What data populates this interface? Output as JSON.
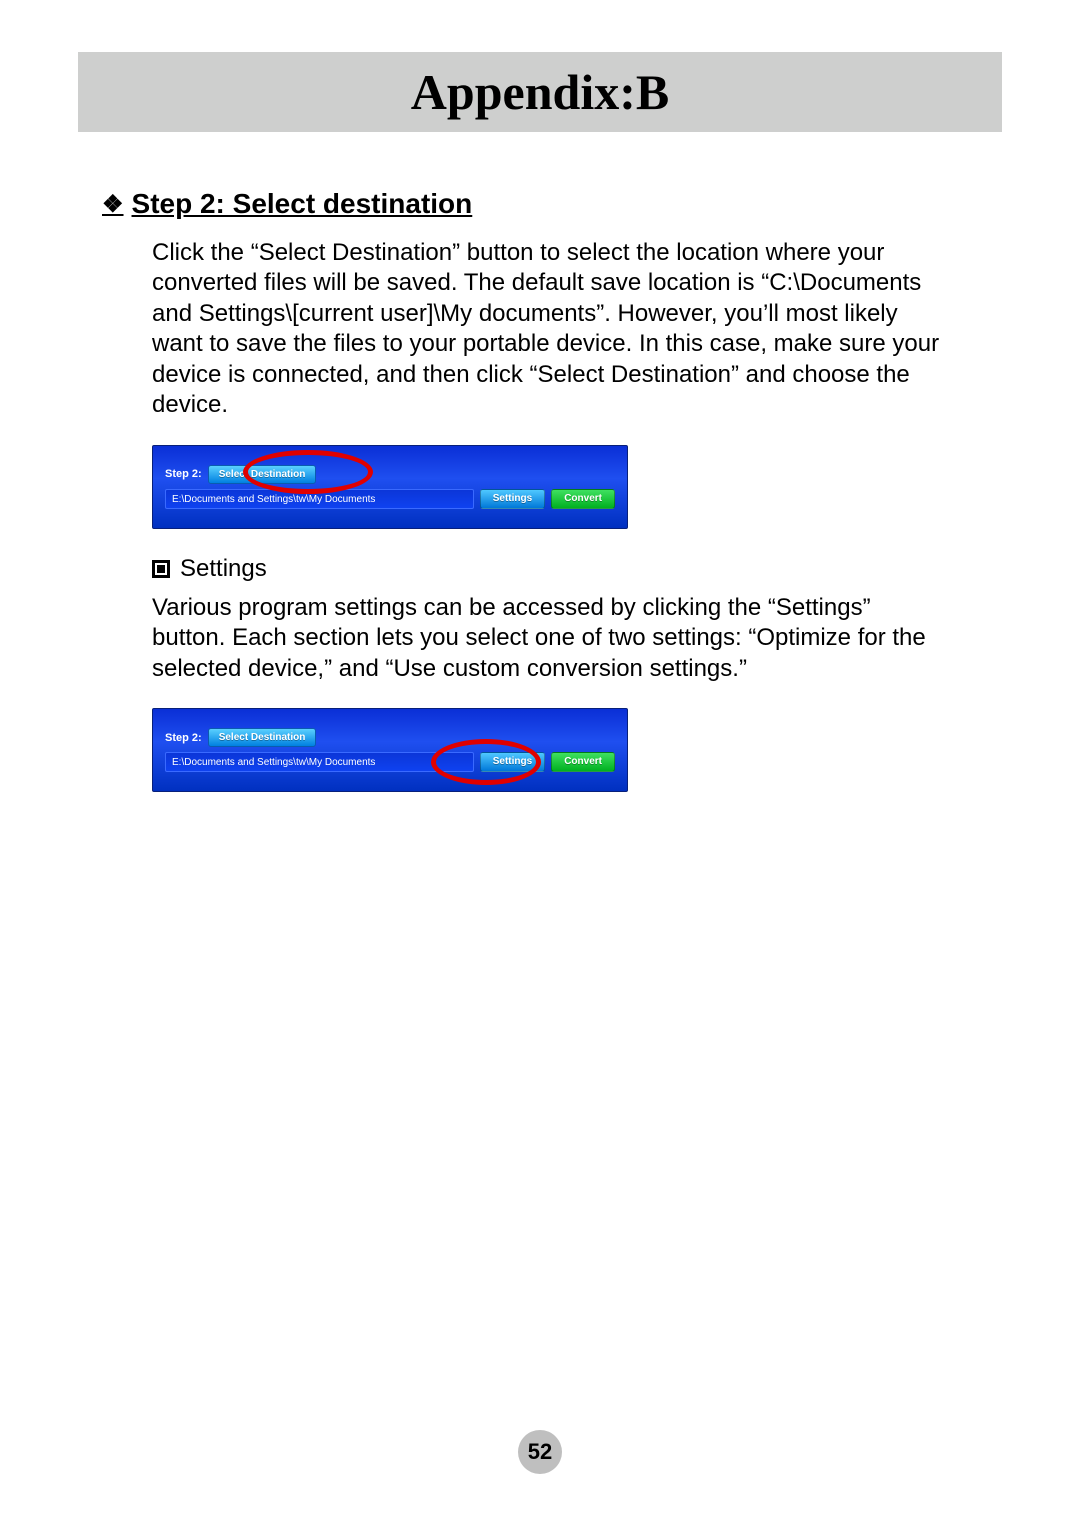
{
  "banner": {
    "title": "Appendix:B"
  },
  "section1": {
    "heading": "Step 2: Select destination",
    "body": "Click the “Select Destination” button to select the location where your converted files will be saved. The default save location is “C:\\Documents and Settings\\[current user]\\My documents”. However, you’ll most likely want to save the files to your portable device. In this case, make sure your device is connected, and then click “Select Destination” and choose the device."
  },
  "figure1": {
    "step_label": "Step 2:",
    "select_btn": "Select Destination",
    "path": "E:\\Documents and Settings\\tw\\My Documents",
    "settings_btn": "Settings",
    "convert_btn": "Convert"
  },
  "section2": {
    "heading": "Settings",
    "body": "Various program settings can be accessed by clicking the “Settings” button. Each section lets you select one of two settings: “Optimize for the selected device,” and “Use custom conversion settings.”"
  },
  "figure2": {
    "step_label": "Step 2:",
    "select_btn": "Select Destination",
    "path": "E:\\Documents and Settings\\tw\\My Documents",
    "settings_btn": "Settings",
    "convert_btn": "Convert"
  },
  "page_number": "52"
}
